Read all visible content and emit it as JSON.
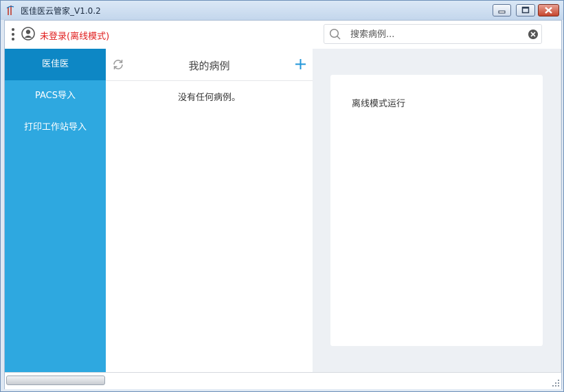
{
  "window": {
    "title": "医佳医云管家_V1.0.2",
    "controls": [
      "minimize-icon",
      "maximize-icon",
      "close-icon"
    ]
  },
  "topbar": {
    "menu_icon": "vertical-dots-icon",
    "avatar_icon": "user-avatar-icon",
    "login_status": "未登录(离线模式)",
    "login_color": "#e02020"
  },
  "search": {
    "placeholder": "搜索病例...",
    "value": "",
    "icon": "search-icon",
    "clear_icon": "clear-icon"
  },
  "sidebar": {
    "bg_color": "#2ea8e0",
    "active_color": "#0d87c5",
    "items": [
      {
        "label": "医佳医",
        "active": true
      },
      {
        "label": "PACS导入",
        "active": false
      },
      {
        "label": "打印工作站导入",
        "active": false
      }
    ]
  },
  "cases": {
    "title": "我的病例",
    "refresh_icon": "refresh-icon",
    "add_icon": "plus-icon",
    "empty_message": "没有任何病例。"
  },
  "detail": {
    "message": "离线模式运行"
  }
}
